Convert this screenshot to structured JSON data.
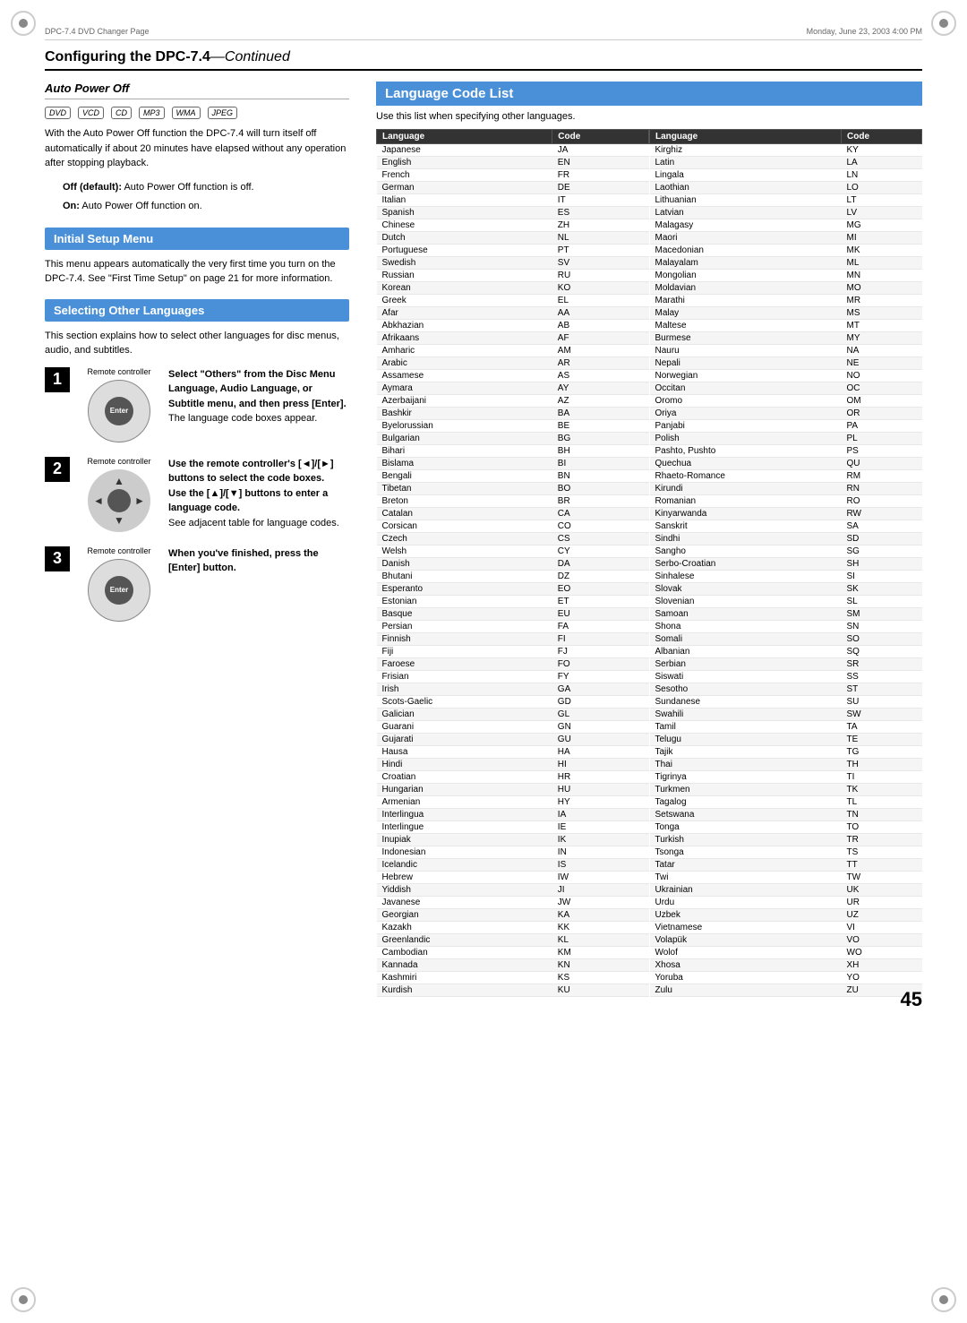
{
  "page": {
    "topbar_left": "DPC-7.4 DVD Changer Page",
    "topbar_right": "Monday, June 23, 2003  4:00 PM",
    "page_number": "45",
    "heading": "Configuring the DPC-7.4",
    "heading_suffix": "—Continued"
  },
  "auto_power_off": {
    "title": "Auto Power Off",
    "formats": [
      "DVD",
      "VCD",
      "CD",
      "MP3",
      "WMA",
      "JPEG"
    ],
    "body": "With the Auto Power Off function the DPC-7.4 will turn itself off automatically if about 20 minutes have elapsed without any operation after stopping playback.",
    "off_label": "Off (default):",
    "off_text": "Auto Power Off function is off.",
    "on_label": "On:",
    "on_text": "Auto Power Off function on."
  },
  "initial_setup": {
    "title": "Initial Setup Menu",
    "body": "This menu appears automatically the very first time you turn on the DPC-7.4. See \"First Time Setup\" on page 21 for more information."
  },
  "selecting_languages": {
    "title": "Selecting Other Languages",
    "body": "This section explains how to select other languages for disc menus, audio, and subtitles.",
    "steps": [
      {
        "number": "1",
        "controller_label": "Remote controller",
        "controller_type": "enter",
        "title": "Select \"Others\" from the Disc Menu Language, Audio Language, or Subtitle menu, and then press [Enter].",
        "subtitle": "The language code boxes appear."
      },
      {
        "number": "2",
        "controller_label": "Remote controller",
        "controller_type": "arrows",
        "title": "Use the remote controller's [◄]/[►] buttons to select the code boxes.",
        "subtitle": "Use the [▲]/[▼] buttons to enter a language code.",
        "extra": "See adjacent table for language codes."
      },
      {
        "number": "3",
        "controller_label": "Remote controller",
        "controller_type": "enter",
        "title": "When you've finished, press the [Enter] button.",
        "subtitle": ""
      }
    ]
  },
  "language_code_list": {
    "title": "Language Code List",
    "subtitle": "Use this list when specifying other languages.",
    "col1_header_lang": "Language",
    "col1_header_code": "Code",
    "col2_header_lang": "Language",
    "col2_header_code": "Code",
    "left_languages": [
      [
        "Japanese",
        "JA"
      ],
      [
        "English",
        "EN"
      ],
      [
        "French",
        "FR"
      ],
      [
        "German",
        "DE"
      ],
      [
        "Italian",
        "IT"
      ],
      [
        "Spanish",
        "ES"
      ],
      [
        "Chinese",
        "ZH"
      ],
      [
        "Dutch",
        "NL"
      ],
      [
        "Portuguese",
        "PT"
      ],
      [
        "Swedish",
        "SV"
      ],
      [
        "Russian",
        "RU"
      ],
      [
        "Korean",
        "KO"
      ],
      [
        "Greek",
        "EL"
      ],
      [
        "Afar",
        "AA"
      ],
      [
        "Abkhazian",
        "AB"
      ],
      [
        "Afrikaans",
        "AF"
      ],
      [
        "Amharic",
        "AM"
      ],
      [
        "Arabic",
        "AR"
      ],
      [
        "Assamese",
        "AS"
      ],
      [
        "Aymara",
        "AY"
      ],
      [
        "Azerbaijani",
        "AZ"
      ],
      [
        "Bashkir",
        "BA"
      ],
      [
        "Byelorussian",
        "BE"
      ],
      [
        "Bulgarian",
        "BG"
      ],
      [
        "Bihari",
        "BH"
      ],
      [
        "Bislama",
        "BI"
      ],
      [
        "Bengali",
        "BN"
      ],
      [
        "Tibetan",
        "BO"
      ],
      [
        "Breton",
        "BR"
      ],
      [
        "Catalan",
        "CA"
      ],
      [
        "Corsican",
        "CO"
      ],
      [
        "Czech",
        "CS"
      ],
      [
        "Welsh",
        "CY"
      ],
      [
        "Danish",
        "DA"
      ],
      [
        "Bhutani",
        "DZ"
      ],
      [
        "Esperanto",
        "EO"
      ],
      [
        "Estonian",
        "ET"
      ],
      [
        "Basque",
        "EU"
      ],
      [
        "Persian",
        "FA"
      ],
      [
        "Finnish",
        "FI"
      ],
      [
        "Fiji",
        "FJ"
      ],
      [
        "Faroese",
        "FO"
      ],
      [
        "Frisian",
        "FY"
      ],
      [
        "Irish",
        "GA"
      ],
      [
        "Scots-Gaelic",
        "GD"
      ],
      [
        "Galician",
        "GL"
      ],
      [
        "Guarani",
        "GN"
      ],
      [
        "Gujarati",
        "GU"
      ],
      [
        "Hausa",
        "HA"
      ],
      [
        "Hindi",
        "HI"
      ],
      [
        "Croatian",
        "HR"
      ],
      [
        "Hungarian",
        "HU"
      ],
      [
        "Armenian",
        "HY"
      ],
      [
        "Interlingua",
        "IA"
      ],
      [
        "Interlingue",
        "IE"
      ],
      [
        "Inupiak",
        "IK"
      ],
      [
        "Indonesian",
        "IN"
      ],
      [
        "Icelandic",
        "IS"
      ],
      [
        "Hebrew",
        "IW"
      ],
      [
        "Yiddish",
        "JI"
      ],
      [
        "Javanese",
        "JW"
      ],
      [
        "Georgian",
        "KA"
      ],
      [
        "Kazakh",
        "KK"
      ],
      [
        "Greenlandic",
        "KL"
      ],
      [
        "Cambodian",
        "KM"
      ],
      [
        "Kannada",
        "KN"
      ],
      [
        "Kashmiri",
        "KS"
      ],
      [
        "Kurdish",
        "KU"
      ]
    ],
    "right_languages": [
      [
        "Kirghiz",
        "KY"
      ],
      [
        "Latin",
        "LA"
      ],
      [
        "Lingala",
        "LN"
      ],
      [
        "Laothian",
        "LO"
      ],
      [
        "Lithuanian",
        "LT"
      ],
      [
        "Latvian",
        "LV"
      ],
      [
        "Malagasy",
        "MG"
      ],
      [
        "Maori",
        "MI"
      ],
      [
        "Macedonian",
        "MK"
      ],
      [
        "Malayalam",
        "ML"
      ],
      [
        "Mongolian",
        "MN"
      ],
      [
        "Moldavian",
        "MO"
      ],
      [
        "Marathi",
        "MR"
      ],
      [
        "Malay",
        "MS"
      ],
      [
        "Maltese",
        "MT"
      ],
      [
        "Burmese",
        "MY"
      ],
      [
        "Nauru",
        "NA"
      ],
      [
        "Nepali",
        "NE"
      ],
      [
        "Norwegian",
        "NO"
      ],
      [
        "Occitan",
        "OC"
      ],
      [
        "Oromo",
        "OM"
      ],
      [
        "Oriya",
        "OR"
      ],
      [
        "Panjabi",
        "PA"
      ],
      [
        "Polish",
        "PL"
      ],
      [
        "Pashto, Pushto",
        "PS"
      ],
      [
        "Quechua",
        "QU"
      ],
      [
        "Rhaeto-Romance",
        "RM"
      ],
      [
        "Kirundi",
        "RN"
      ],
      [
        "Romanian",
        "RO"
      ],
      [
        "Kinyarwanda",
        "RW"
      ],
      [
        "Sanskrit",
        "SA"
      ],
      [
        "Sindhi",
        "SD"
      ],
      [
        "Sangho",
        "SG"
      ],
      [
        "Serbo-Croatian",
        "SH"
      ],
      [
        "Sinhalese",
        "SI"
      ],
      [
        "Slovak",
        "SK"
      ],
      [
        "Slovenian",
        "SL"
      ],
      [
        "Samoan",
        "SM"
      ],
      [
        "Shona",
        "SN"
      ],
      [
        "Somali",
        "SO"
      ],
      [
        "Albanian",
        "SQ"
      ],
      [
        "Serbian",
        "SR"
      ],
      [
        "Siswati",
        "SS"
      ],
      [
        "Sesotho",
        "ST"
      ],
      [
        "Sundanese",
        "SU"
      ],
      [
        "Swahili",
        "SW"
      ],
      [
        "Tamil",
        "TA"
      ],
      [
        "Telugu",
        "TE"
      ],
      [
        "Tajik",
        "TG"
      ],
      [
        "Thai",
        "TH"
      ],
      [
        "Tigrinya",
        "TI"
      ],
      [
        "Turkmen",
        "TK"
      ],
      [
        "Tagalog",
        "TL"
      ],
      [
        "Setswana",
        "TN"
      ],
      [
        "Tonga",
        "TO"
      ],
      [
        "Turkish",
        "TR"
      ],
      [
        "Tsonga",
        "TS"
      ],
      [
        "Tatar",
        "TT"
      ],
      [
        "Twi",
        "TW"
      ],
      [
        "Ukrainian",
        "UK"
      ],
      [
        "Urdu",
        "UR"
      ],
      [
        "Uzbek",
        "UZ"
      ],
      [
        "Vietnamese",
        "VI"
      ],
      [
        "Volapük",
        "VO"
      ],
      [
        "Wolof",
        "WO"
      ],
      [
        "Xhosa",
        "XH"
      ],
      [
        "Yoruba",
        "YO"
      ],
      [
        "Zulu",
        "ZU"
      ]
    ]
  }
}
